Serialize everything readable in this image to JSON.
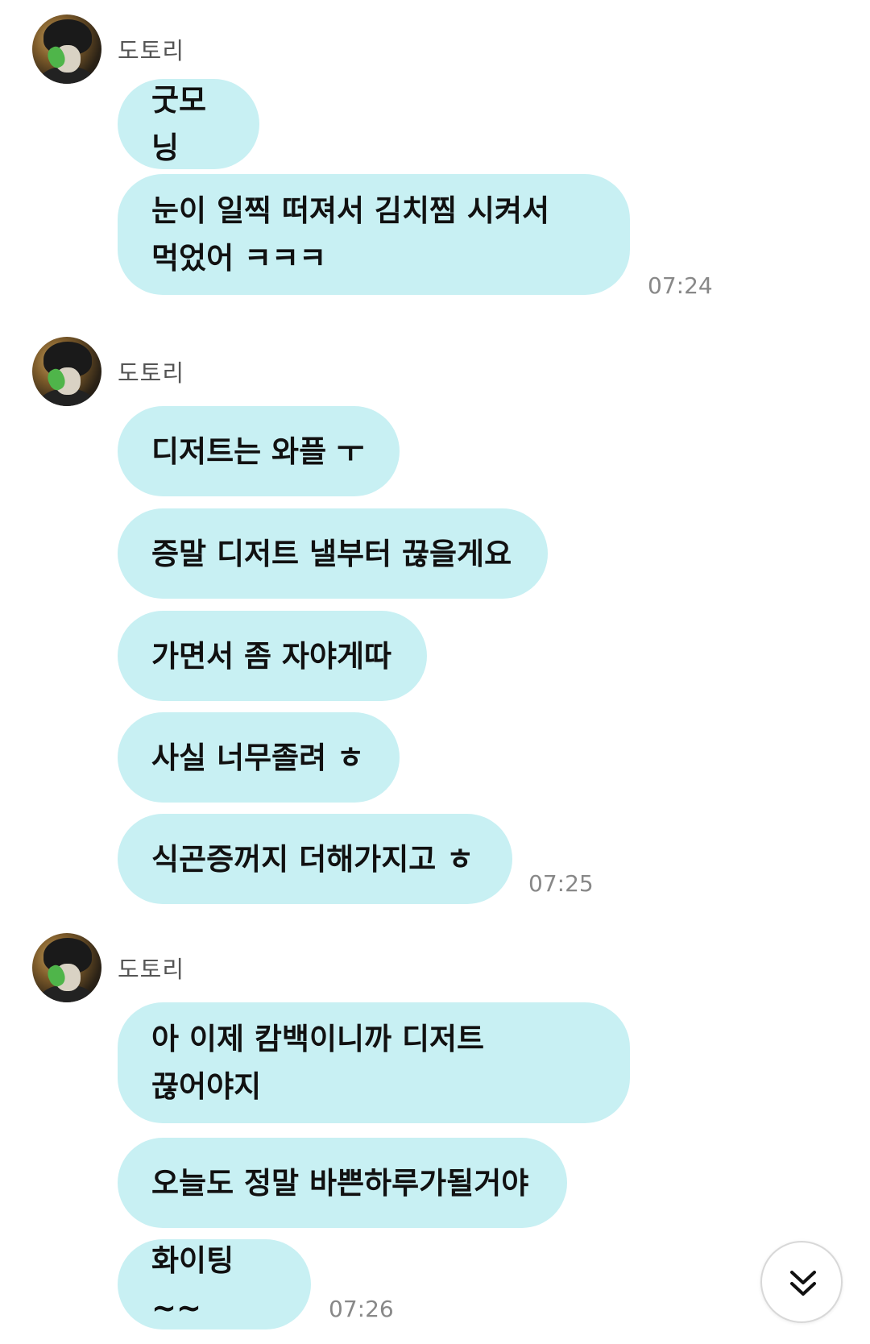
{
  "messages": [
    {
      "sender": "도토리",
      "time": "07:24",
      "bubbles": [
        "굿모닝",
        "눈이 일찍 떠져서 김치찜 시켜서\n먹었어 ㅋㅋㅋ"
      ]
    },
    {
      "sender": "도토리",
      "time": "07:25",
      "bubbles": [
        "디저트는 와플 ㅜ",
        "증말 디저트 낼부터 끊을게요",
        "가면서 좀 자야게따",
        "사실 너무졸려 ㅎ",
        "식곤증꺼지 더해가지고 ㅎ"
      ]
    },
    {
      "sender": "도토리",
      "time": "07:26",
      "bubbles": [
        "아 이제 캄백이니까 디저트\n끊어야지",
        "오늘도 정말 바쁜하루가될거야",
        "화이팅~~"
      ]
    }
  ],
  "scroll_button": {
    "icon": "double-chevron-down-icon"
  },
  "colors": {
    "bubble": "#c8f0f3",
    "sender": "#555555",
    "time": "#888888",
    "text": "#111111"
  }
}
